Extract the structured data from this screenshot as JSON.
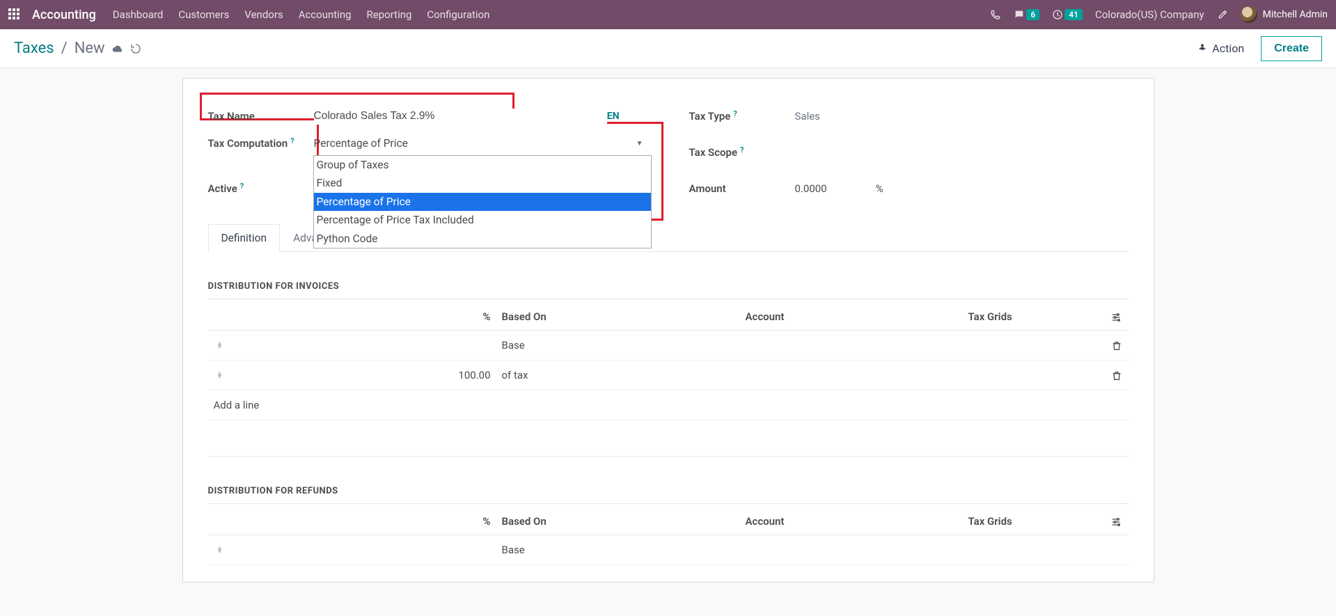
{
  "topbar": {
    "app_name": "Accounting",
    "menu": [
      "Dashboard",
      "Customers",
      "Vendors",
      "Accounting",
      "Reporting",
      "Configuration"
    ],
    "messages_badge": "6",
    "activities_badge": "41",
    "company": "Colorado(US) Company",
    "user_name": "Mitchell Admin"
  },
  "subbar": {
    "breadcrumb_root": "Taxes",
    "breadcrumb_current": "New",
    "action_label": "Action",
    "create_label": "Create"
  },
  "form": {
    "tax_name_label": "Tax Name",
    "tax_name_value": "Colorado Sales Tax 2.9%",
    "lang_chip": "EN",
    "tax_type_label": "Tax Type",
    "tax_type_value": "Sales",
    "tax_computation_label": "Tax Computation",
    "tax_computation_value": "Percentage of Price",
    "tax_computation_options": [
      "Group of Taxes",
      "Fixed",
      "Percentage of Price",
      "Percentage of Price Tax Included",
      "Python Code"
    ],
    "tax_scope_label": "Tax Scope",
    "active_label": "Active",
    "amount_label": "Amount",
    "amount_value": "0.0000",
    "amount_unit": "%"
  },
  "tabs": {
    "definition": "Definition",
    "advanced": "Advanced Options"
  },
  "dist_invoices": {
    "title": "DISTRIBUTION FOR INVOICES",
    "columns": {
      "pct": "%",
      "based_on": "Based On",
      "account": "Account",
      "tax_grids": "Tax Grids"
    },
    "rows": [
      {
        "pct": "",
        "based_on": "Base"
      },
      {
        "pct": "100.00",
        "based_on": "of tax"
      }
    ],
    "add_line": "Add a line"
  },
  "dist_refunds": {
    "title": "DISTRIBUTION FOR REFUNDS",
    "columns": {
      "pct": "%",
      "based_on": "Based On",
      "account": "Account",
      "tax_grids": "Tax Grids"
    },
    "rows": [
      {
        "pct": "",
        "based_on": "Base"
      }
    ]
  }
}
